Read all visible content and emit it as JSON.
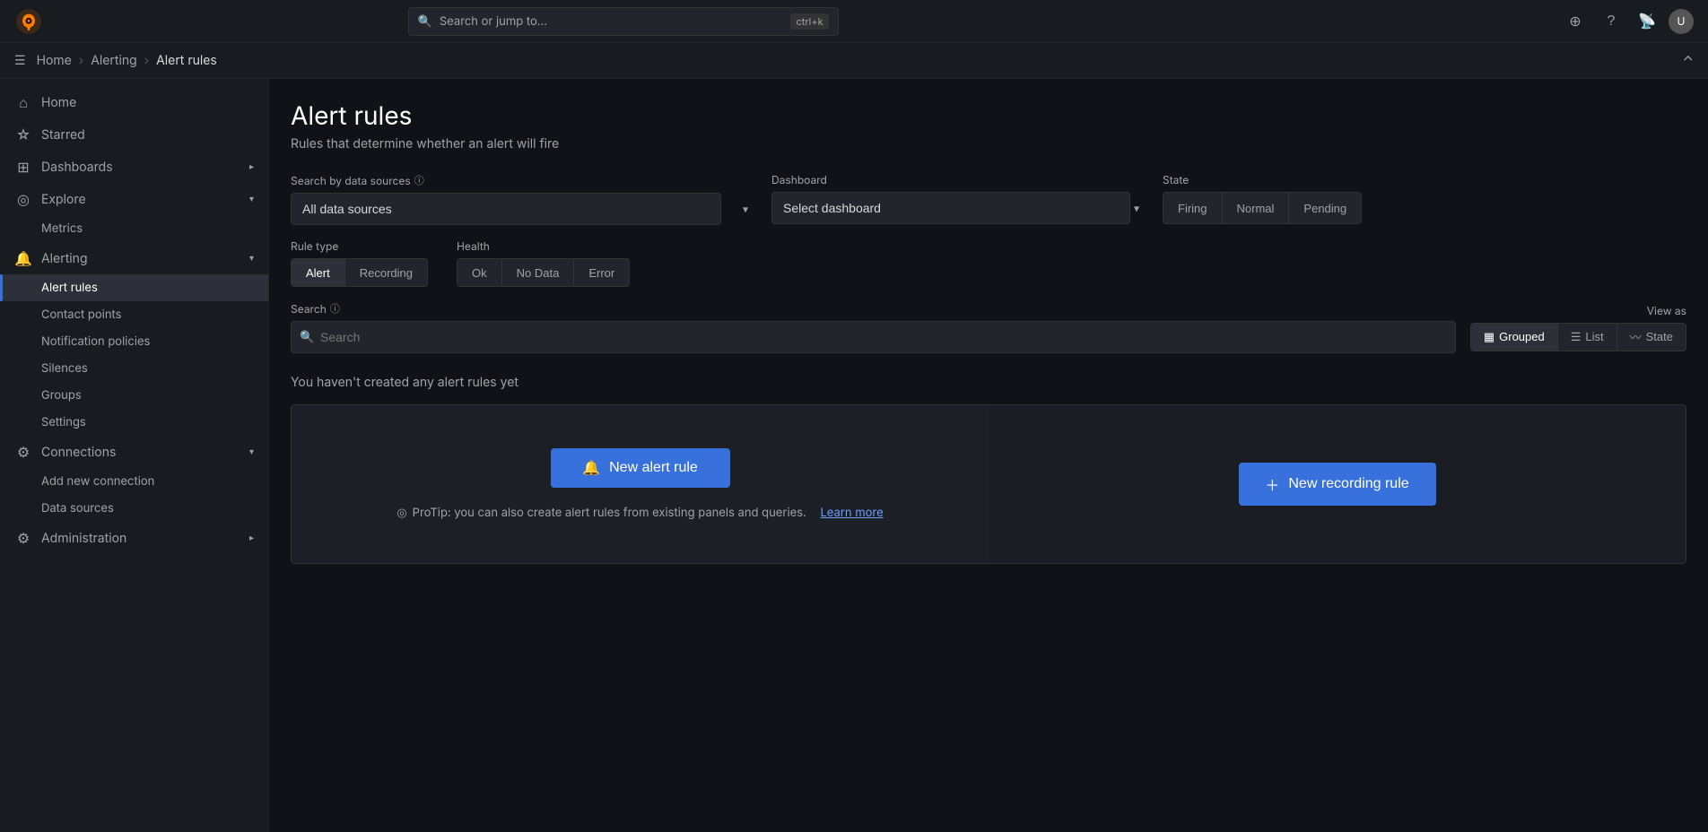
{
  "topbar": {
    "search_placeholder": "Search or jump to...",
    "search_shortcut": "ctrl+k",
    "plus_label": "+",
    "help_label": "?",
    "rss_label": "RSS"
  },
  "breadcrumb": {
    "home": "Home",
    "alerting": "Alerting",
    "current": "Alert rules"
  },
  "sidebar": {
    "home": "Home",
    "starred": "Starred",
    "dashboards": "Dashboards",
    "explore": "Explore",
    "explore_metrics": "Metrics",
    "alerting": "Alerting",
    "alert_rules": "Alert rules",
    "contact_points": "Contact points",
    "notification_policies": "Notification policies",
    "silences": "Silences",
    "groups": "Groups",
    "settings": "Settings",
    "connections": "Connections",
    "add_new_connection": "Add new connection",
    "data_sources": "Data sources",
    "administration": "Administration"
  },
  "page": {
    "title": "Alert rules",
    "subtitle": "Rules that determine whether an alert will fire"
  },
  "filters": {
    "datasource_label": "Search by data sources",
    "datasource_value": "All data sources",
    "dashboard_label": "Dashboard",
    "dashboard_placeholder": "Select dashboard",
    "state_label": "State",
    "state_firing": "Firing",
    "state_normal": "Normal",
    "state_pending": "Pending",
    "rule_type_label": "Rule type",
    "rule_type_alert": "Alert",
    "rule_type_recording": "Recording",
    "health_label": "Health",
    "health_ok": "Ok",
    "health_no_data": "No Data",
    "health_error": "Error",
    "search_label": "Search",
    "search_placeholder": "Search"
  },
  "view_as": {
    "label": "View as",
    "grouped": "Grouped",
    "list": "List",
    "state": "State"
  },
  "empty": {
    "message": "You haven't created any alert rules yet"
  },
  "cta": {
    "new_alert_rule": "New alert rule",
    "new_recording_rule": "New recording rule",
    "protip": "ProTip: you can also create alert rules from existing panels and queries.",
    "learn_more": "Learn more"
  }
}
